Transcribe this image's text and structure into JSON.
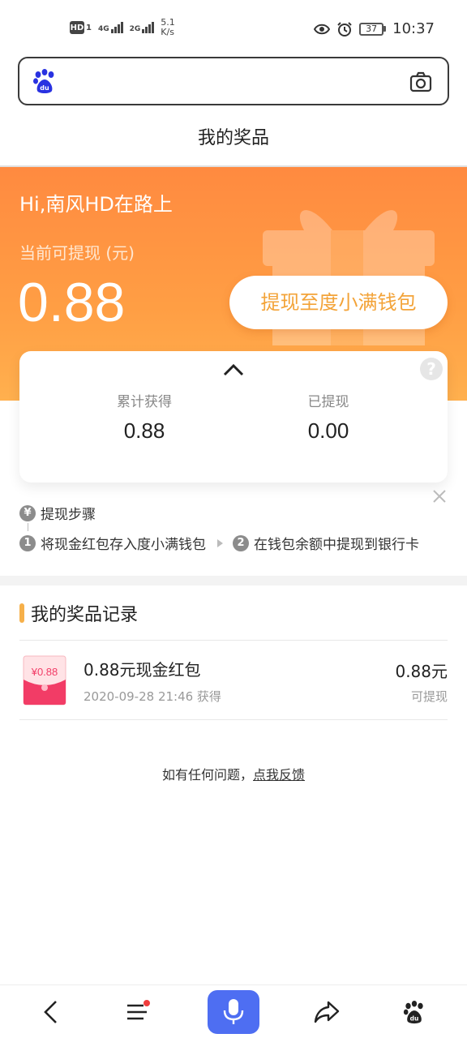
{
  "status_bar": {
    "hd_label": "HD",
    "hd_sim": "1",
    "net1": "4G",
    "net2": "2G",
    "speed_value": "5.1",
    "speed_unit": "K/s",
    "battery": "37",
    "time": "10:37"
  },
  "search": {
    "logo_icon": "baidu-paw-logo",
    "camera_icon": "camera-icon"
  },
  "page": {
    "title": "我的奖品"
  },
  "hero": {
    "greeting": "Hi,南风HD在路上",
    "sublabel": "当前可提现 (元)",
    "amount": "0.88",
    "withdraw_button": "提现至度小满钱包"
  },
  "stats": {
    "total_label": "累计获得",
    "total_value": "0.88",
    "withdrawn_label": "已提现",
    "withdrawn_value": "0.00",
    "help_symbol": "?"
  },
  "steps": {
    "title": "提现步骤",
    "yen_symbol": "¥",
    "step1_num": "1",
    "step1_text": "将现金红包存入度小满钱包",
    "step2_num": "2",
    "step2_text": "在钱包余额中提现到银行卡"
  },
  "records": {
    "title": "我的奖品记录",
    "items": [
      {
        "thumb_label": "¥0.88",
        "title": "0.88元现金红包",
        "time": "2020-09-28 21:46 获得",
        "amount": "0.88元",
        "status": "可提现"
      }
    ]
  },
  "feedback": {
    "prefix": "如有任何问题，",
    "link": "点我反馈"
  },
  "bottom_nav": {
    "back_icon": "back-icon",
    "menu_icon": "menu-icon",
    "mic_icon": "mic-icon",
    "share_icon": "share-icon",
    "home_icon": "baidu-paw-icon"
  },
  "colors": {
    "hero_orange": "#ff9a44",
    "button_text": "#f3a338",
    "accent_bar": "#f6b04a",
    "mic_blue": "#4e6ef2",
    "notify_red": "#f03d3d"
  }
}
